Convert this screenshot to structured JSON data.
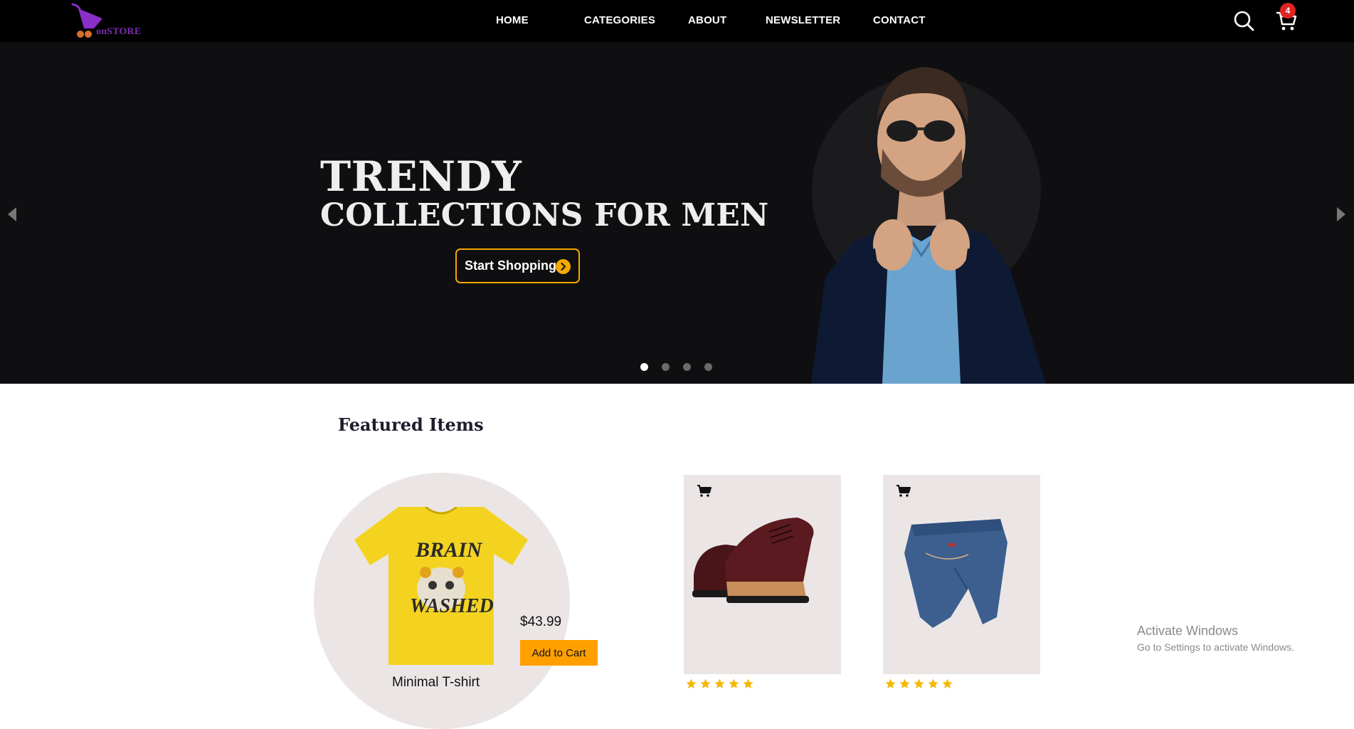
{
  "brand": {
    "name": "onSTORE",
    "accent_color": "#7b2ab0"
  },
  "nav": {
    "links": [
      "HOME",
      "CATEGORIES",
      "ABOUT",
      "NEWSLETTER",
      "CONTACT"
    ],
    "search_icon": "search-icon",
    "cart_icon": "cart-icon",
    "cart_count": "4"
  },
  "hero": {
    "title_line_1": "TRENDY",
    "title_line_2": "COLLECTIONS FOR MEN",
    "cta_label": "Start Shopping",
    "cta_color": "#f5a800",
    "slides_total": 4,
    "active_slide": 1
  },
  "featured": {
    "heading": "Featured Items",
    "highlight": {
      "name": "Minimal T-shirt",
      "price": "$43.99",
      "button_label": "Add to Cart",
      "button_color": "#ffa000"
    },
    "products": [
      {
        "image": "leather-shoes",
        "rating": 5
      },
      {
        "image": "denim-jeans",
        "rating": 5
      }
    ]
  },
  "system": {
    "watermark_title": "Activate Windows",
    "watermark_sub": "Go to Settings to activate Windows."
  }
}
